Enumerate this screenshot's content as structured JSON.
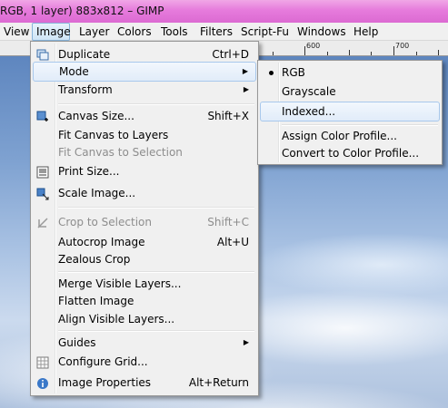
{
  "window": {
    "title": "RGB, 1 layer) 883x812 – GIMP"
  },
  "menubar": [
    {
      "label": "View",
      "name": "menu-view"
    },
    {
      "label": "Image",
      "name": "menu-image"
    },
    {
      "label": "Layer",
      "name": "menu-layer"
    },
    {
      "label": "Colors",
      "name": "menu-colors"
    },
    {
      "label": "Tools",
      "name": "menu-tools"
    },
    {
      "label": "Filters",
      "name": "menu-filters"
    },
    {
      "label": "Script-Fu",
      "name": "menu-script-fu"
    },
    {
      "label": "Windows",
      "name": "menu-windows"
    },
    {
      "label": "Help",
      "name": "menu-help"
    }
  ],
  "ruler": {
    "labels": [
      "600",
      "700"
    ]
  },
  "image_menu": {
    "items": [
      {
        "label": "Duplicate",
        "accel": "Ctrl+D",
        "icon": "duplicate-icon"
      },
      {
        "label": "Mode",
        "submenu": true
      },
      {
        "label": "Transform",
        "submenu": true
      },
      {
        "label": "Canvas Size...",
        "accel": "Shift+X",
        "icon": "canvas-size-icon"
      },
      {
        "label": "Fit Canvas to Layers"
      },
      {
        "label": "Fit Canvas to Selection",
        "disabled": true
      },
      {
        "label": "Print Size...",
        "icon": "print-size-icon"
      },
      {
        "label": "Scale Image...",
        "icon": "scale-image-icon"
      },
      {
        "label": "Crop to Selection",
        "accel": "Shift+C",
        "disabled": true,
        "icon": "crop-icon"
      },
      {
        "label": "Autocrop Image",
        "accel": "Alt+U"
      },
      {
        "label": "Zealous Crop"
      },
      {
        "label": "Merge Visible Layers..."
      },
      {
        "label": "Flatten Image"
      },
      {
        "label": "Align Visible Layers..."
      },
      {
        "label": "Guides",
        "submenu": true
      },
      {
        "label": "Configure Grid...",
        "icon": "grid-icon"
      },
      {
        "label": "Image Properties",
        "accel": "Alt+Return",
        "icon": "info-icon"
      }
    ]
  },
  "mode_submenu": {
    "items": [
      {
        "label": "RGB",
        "selected": true
      },
      {
        "label": "Grayscale"
      },
      {
        "label": "Indexed..."
      },
      {
        "label": "Assign Color Profile..."
      },
      {
        "label": "Convert to Color Profile..."
      }
    ]
  }
}
